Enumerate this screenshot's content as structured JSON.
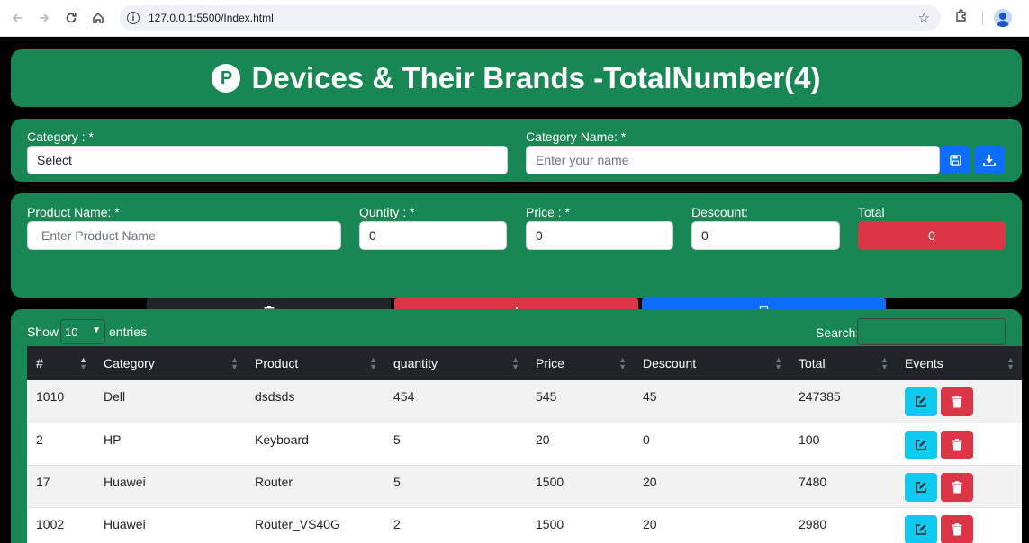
{
  "browser": {
    "url": "127.0.0.1:5500/Index.html"
  },
  "header": {
    "logo_letter": "P",
    "title": "Devices & Their Brands -TotalNumber(4)"
  },
  "category_form": {
    "category_label": "Category : *",
    "category_value": "Select",
    "category_name_label": "Category Name: *",
    "category_name_placeholder": "Enter your name"
  },
  "product_form": {
    "product_name_label": "Product Name: *",
    "product_name_placeholder": "Enter Product Name",
    "quantity_label": "Quntity : *",
    "quantity_value": "0",
    "price_label": "Price : *",
    "price_value": "0",
    "discount_label": "Descount:",
    "discount_value": "0",
    "total_label": "Total",
    "total_value": "0"
  },
  "table_controls": {
    "show_label": "Show",
    "entries_value": "10",
    "entries_label": "entries",
    "search_label": "Search:"
  },
  "table": {
    "columns": [
      "#",
      "Category",
      "Product",
      "quantity",
      "Price",
      "Descount",
      "Total",
      "Events"
    ],
    "rows": [
      [
        "1010",
        "Dell",
        "dsdsds",
        "454",
        "545",
        "45",
        "247385"
      ],
      [
        "2",
        "HP",
        "Keyboard",
        "5",
        "20",
        "0",
        "100"
      ],
      [
        "17",
        "Huawei",
        "Router",
        "5",
        "1500",
        "20",
        "7480"
      ],
      [
        "1002",
        "Huawei",
        "Router_VS40G",
        "2",
        "1500",
        "20",
        "2980"
      ]
    ]
  },
  "colors": {
    "brand_green": "#198754",
    "primary_blue": "#0d6efd",
    "danger_red": "#dc3545",
    "info_cyan": "#0dcaf0",
    "dark": "#212529"
  },
  "icons": {
    "save": "floppy-disk-icon",
    "download": "download-icon",
    "delete_all": "trash-icon",
    "print": "print-icon",
    "edit": "edit-icon"
  }
}
